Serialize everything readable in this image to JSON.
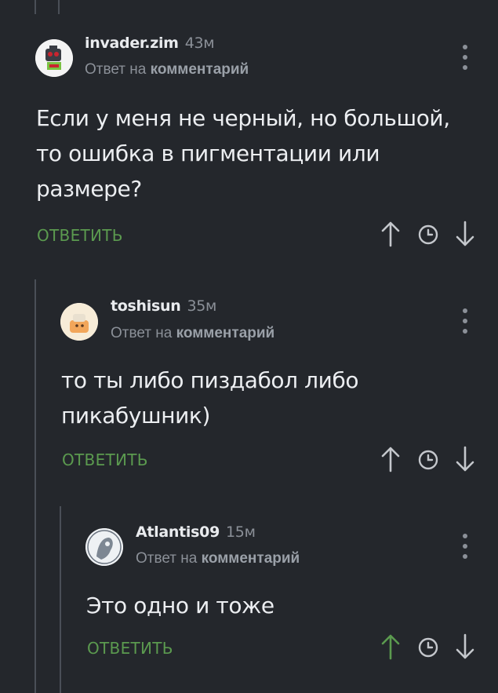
{
  "comments": [
    {
      "username": "invader.zim",
      "time": "43м",
      "reply_prefix": "Ответ на",
      "reply_target": "комментарий",
      "text_lines": [
        "Если у меня не черный, но большой,",
        "то ошибка в пигментации или",
        "размере?"
      ],
      "reply_label": "ОТВЕТИТЬ",
      "upvoted": false
    },
    {
      "username": "toshisun",
      "time": "35м",
      "reply_prefix": "Ответ на",
      "reply_target": "комментарий",
      "text_lines": [
        "то ты либо пиздабол либо",
        "пикабушник)"
      ],
      "reply_label": "ОТВЕТИТЬ",
      "upvoted": false
    },
    {
      "username": "Atlantis09",
      "time": "15м",
      "reply_prefix": "Ответ на",
      "reply_target": "комментарий",
      "text_lines": [
        "Это одно и тоже"
      ],
      "reply_label": "ОТВЕТИТЬ",
      "upvoted": true
    }
  ],
  "colors": {
    "background": "#24272c",
    "accent_green": "#5b9a4f",
    "thread_line": "#4a4f57",
    "muted_text": "#8b9098"
  },
  "icons": [
    "arrow-up-icon",
    "clock-icon",
    "arrow-down-icon",
    "more-vertical-icon"
  ]
}
